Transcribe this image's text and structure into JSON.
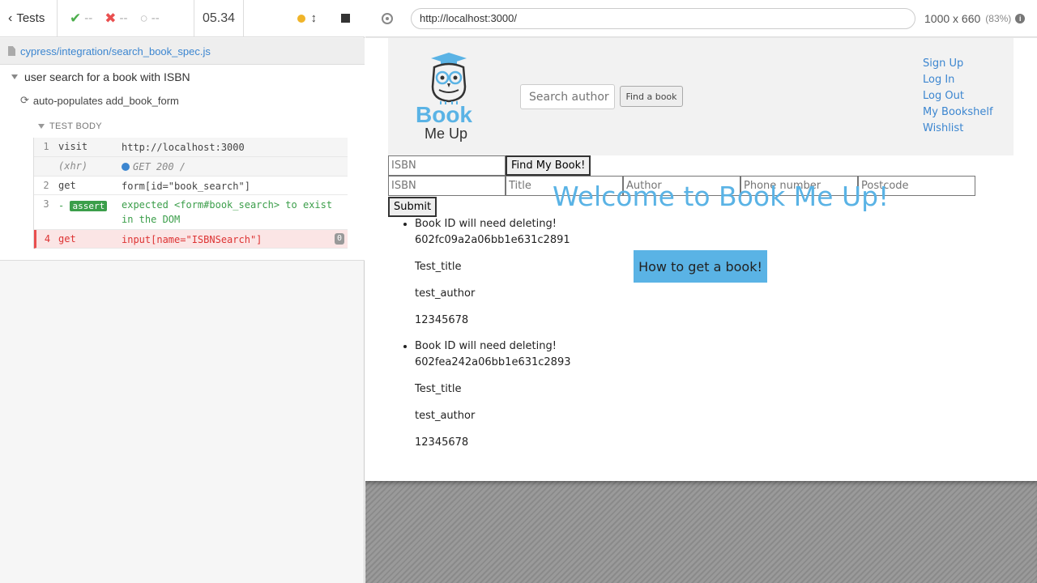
{
  "reporter": {
    "tests_label": "Tests",
    "stats": {
      "passed": "--",
      "failed": "--",
      "pending": "--"
    },
    "timer": "05.34",
    "spec_path": "cypress/integration/search_book_spec.js",
    "suite_title": "user search for a book with ISBN",
    "test_title": "auto-populates add_book_form",
    "test_body_label": "TEST BODY",
    "commands": [
      {
        "num": "1",
        "name": "visit",
        "message": "http://localhost:3000"
      },
      {
        "num": "",
        "name": "(xhr)",
        "message": "GET 200 /"
      },
      {
        "num": "2",
        "name": "get",
        "message": "form[id=\"book_search\"]"
      },
      {
        "num": "3",
        "name": "-",
        "badge": "assert",
        "message": "expected <form#book_search> to exist in the DOM"
      },
      {
        "num": "4",
        "name": "get",
        "message": "input[name=\"ISBNSearch\"]",
        "count": "0"
      }
    ]
  },
  "aut": {
    "url": "http://localhost:3000/",
    "viewport_size": "1000 x 660",
    "viewport_pct": "(83%)"
  },
  "app": {
    "logo_line1": "Book",
    "logo_line2": "Me Up",
    "search_placeholder": "Search author",
    "find_book_label": "Find a book",
    "nav_links": [
      "Sign Up",
      "Log In",
      "Log Out",
      "My Bookshelf",
      "Wishlist"
    ],
    "isbn_search_placeholder": "ISBN",
    "find_my_book_label": "Find My Book!",
    "add_form_placeholders": [
      "ISBN",
      "Title",
      "Author",
      "Phone number",
      "Postcode"
    ],
    "submit_label": "Submit",
    "welcome": "Welcome to Book Me Up!",
    "how_button": "How to get a book!",
    "books": [
      {
        "note": "Book ID will need deleting!",
        "id": "602fc09a2a06bb1e631c2891",
        "title": "Test_title",
        "author": "test_author",
        "isbn": "12345678"
      },
      {
        "note": "Book ID will need deleting!",
        "id": "602fea242a06bb1e631c2893",
        "title": "Test_title",
        "author": "test_author",
        "isbn": "12345678"
      }
    ]
  },
  "colors": {
    "accent": "#5ab3e5",
    "link": "#3c86d0",
    "pass": "#3b9e4a",
    "fail": "#e94f4f"
  }
}
